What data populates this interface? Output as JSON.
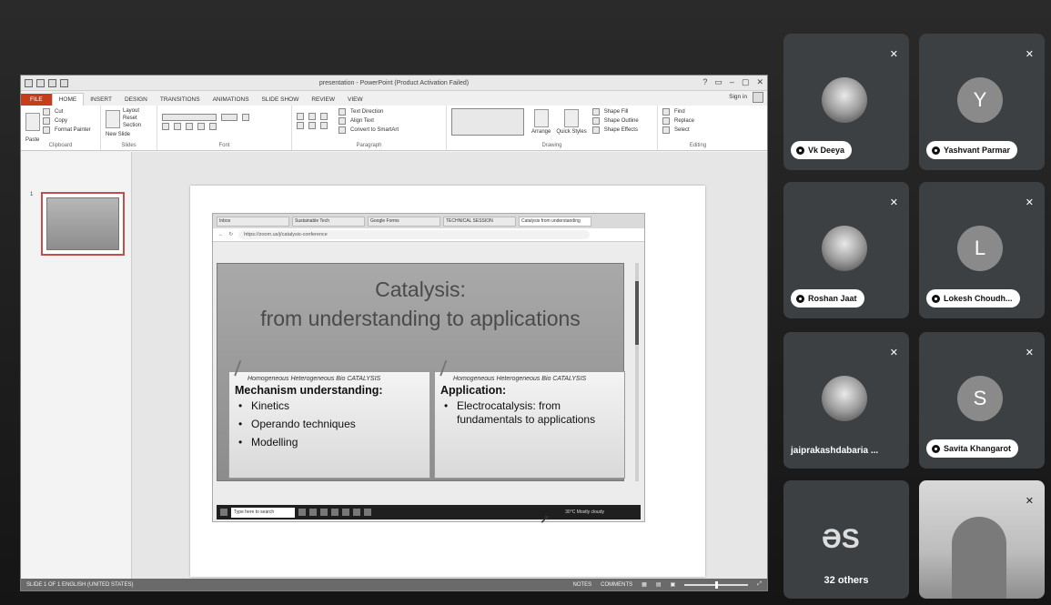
{
  "powerpoint": {
    "doc_title": "presentation - PowerPoint (Product Activation Failed)",
    "window_controls": [
      "?",
      "▭",
      "–",
      "▢",
      "✕"
    ],
    "tabs": [
      "FILE",
      "HOME",
      "INSERT",
      "DESIGN",
      "TRANSITIONS",
      "ANIMATIONS",
      "SLIDE SHOW",
      "REVIEW",
      "VIEW"
    ],
    "active_tab": "HOME",
    "sign_in": "Sign in",
    "ribbon": {
      "clipboard": {
        "paste": "Paste",
        "cut": "Cut",
        "copy": "Copy",
        "format_painter": "Format Painter",
        "label": "Clipboard"
      },
      "slides": {
        "new_slide": "New Slide",
        "layout": "Layout",
        "reset": "Reset",
        "section": "Section",
        "label": "Slides"
      },
      "font": {
        "label": "Font"
      },
      "paragraph": {
        "text_direction": "Text Direction",
        "align_text": "Align Text",
        "convert_smartart": "Convert to SmartArt",
        "label": "Paragraph"
      },
      "drawing": {
        "arrange": "Arrange",
        "quick_styles": "Quick Styles",
        "shape_fill": "Shape Fill",
        "shape_outline": "Shape Outline",
        "shape_effects": "Shape Effects",
        "label": "Drawing"
      },
      "editing": {
        "find": "Find",
        "replace": "Replace",
        "select": "Select",
        "label": "Editing"
      }
    },
    "thumbnail_number": "1",
    "slide": {
      "browser": {
        "tabs": [
          "Inbox",
          "Sustainable Tech",
          "Google Forms",
          "TECHNICAL SESSION",
          "Catalysis from understanding"
        ],
        "address": "https://zoom.us/j/catalysis-conference"
      },
      "presentation": {
        "title_line1": "Catalysis:",
        "title_line2": "from understanding to applications",
        "left_card": {
          "subtitle": "Homogeneous Heterogeneous Bio CATALYSIS",
          "heading": "Mechanism understanding:",
          "bullets": [
            "Kinetics",
            "Operando techniques",
            "Modelling"
          ]
        },
        "right_card": {
          "subtitle": "Homogeneous Heterogeneous Bio CATALYSIS",
          "heading": "Application:",
          "bullets": [
            "Electrocatalysis: from fundamentals to applications"
          ]
        }
      },
      "taskbar": {
        "search_placeholder": "Type here to search",
        "weather": "30°C Mostly cloudy"
      }
    },
    "status": {
      "left": "SLIDE 1 OF 1    ENGLISH (UNITED STATES)",
      "notes": "NOTES",
      "comments": "COMMENTS"
    }
  },
  "meet": {
    "participants": [
      {
        "name": "Vk Deeya",
        "type": "photo"
      },
      {
        "name": "Yashvant Parmar",
        "type": "letter",
        "initial": "Y"
      },
      {
        "name": "Roshan Jaat",
        "type": "photo"
      },
      {
        "name": "Lokesh Choudh...",
        "type": "letter",
        "initial": "L"
      },
      {
        "name": "jaiprakashdabaria ...",
        "type": "photo"
      },
      {
        "name": "Savita Khangarot",
        "type": "letter",
        "initial": "S"
      }
    ],
    "others_count": "32 others",
    "mic_icon": "mic-off-icon"
  }
}
